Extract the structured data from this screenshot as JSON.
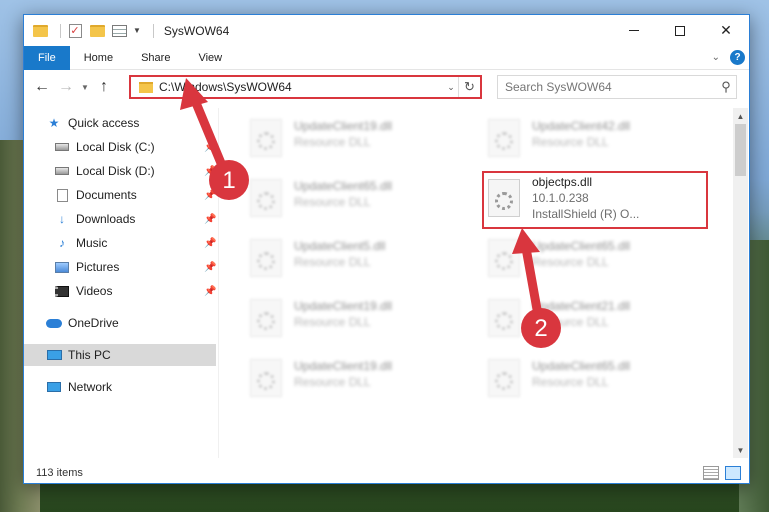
{
  "window": {
    "title": "SysWOW64"
  },
  "ribbon": {
    "tabs": [
      "File",
      "Home",
      "Share",
      "View"
    ]
  },
  "address": {
    "path": "C:\\Windows\\SysWOW64"
  },
  "search": {
    "placeholder": "Search SysWOW64"
  },
  "nav": {
    "quick_access": "Quick access",
    "items": [
      {
        "label": "Local Disk (C:)",
        "icon": "drive-icon",
        "pinned": true
      },
      {
        "label": "Local Disk (D:)",
        "icon": "drive-icon",
        "pinned": true
      },
      {
        "label": "Documents",
        "icon": "documents-icon",
        "pinned": true
      },
      {
        "label": "Downloads",
        "icon": "downloads-icon",
        "pinned": true
      },
      {
        "label": "Music",
        "icon": "music-icon",
        "pinned": true
      },
      {
        "label": "Pictures",
        "icon": "pictures-icon",
        "pinned": true
      },
      {
        "label": "Videos",
        "icon": "videos-icon",
        "pinned": true
      }
    ],
    "onedrive": "OneDrive",
    "thispc": "This PC",
    "network": "Network"
  },
  "files": [
    {
      "name": "UpdateClient19.dll",
      "sub": "Resource DLL",
      "blurred": true
    },
    {
      "name": "UpdateClient42.dll",
      "sub": "Resource DLL",
      "blurred": true
    },
    {
      "name": "UpdateClient65.dll",
      "sub": "Resource DLL",
      "blurred": true
    },
    {
      "name": "objectps.dll",
      "version": "10.1.0.238",
      "company": "InstallShield (R) O...",
      "blurred": false
    },
    {
      "name": "UpdateClient5.dll",
      "sub": "Resource DLL",
      "blurred": true
    },
    {
      "name": "UpdateClient65.dll",
      "sub": "Resource DLL",
      "blurred": true
    },
    {
      "name": "UpdateClient19.dll",
      "sub": "Resource DLL",
      "blurred": true
    },
    {
      "name": "UpdateClient21.dll",
      "sub": "Resource DLL",
      "blurred": true
    },
    {
      "name": "UpdateClient19.dll",
      "sub": "Resource DLL",
      "blurred": true
    },
    {
      "name": "UpdateClient65.dll",
      "sub": "Resource DLL",
      "blurred": true
    }
  ],
  "status": {
    "count": "113 items"
  },
  "annotations": {
    "step1": "1",
    "step2": "2",
    "color": "#d9363e"
  },
  "colors": {
    "accent": "#1979ca",
    "highlight": "#d9363e"
  }
}
